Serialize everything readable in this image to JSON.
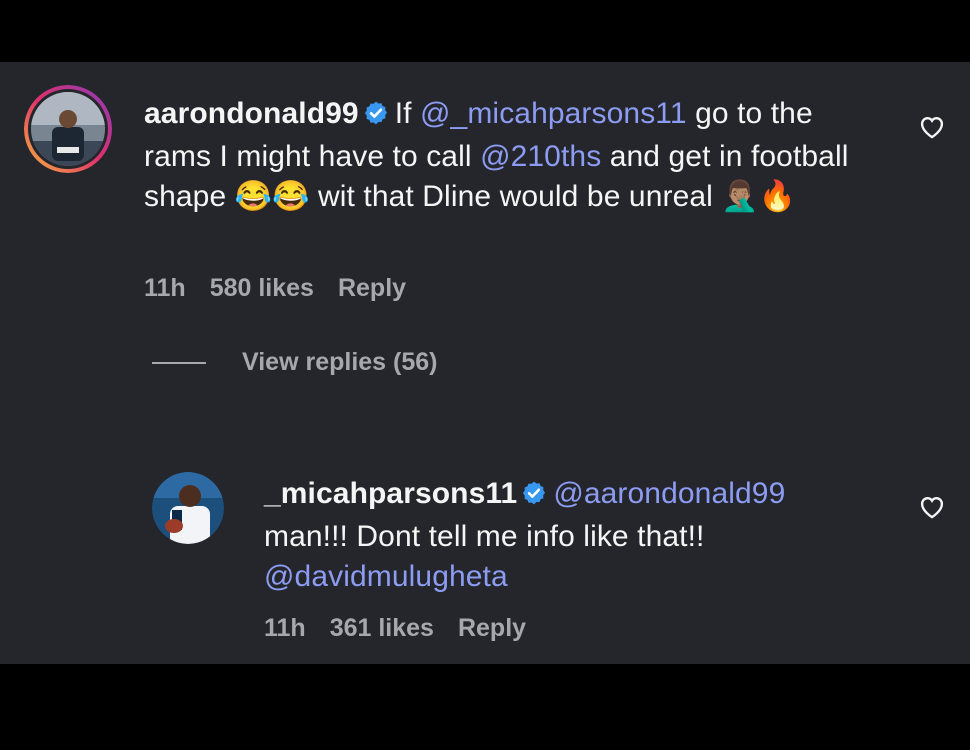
{
  "comments": [
    {
      "username": "aarondonald99",
      "verified": true,
      "text_parts": [
        {
          "text": "If ",
          "mention": false
        },
        {
          "text": "@_micahparsons11",
          "mention": true
        },
        {
          "text": " go to the rams I might have to call ",
          "mention": false
        },
        {
          "text": "@210ths",
          "mention": true
        },
        {
          "text": " and get in football shape 😂😂 wit that Dline would be unreal 🤦🏽‍♂️🔥",
          "mention": false
        }
      ],
      "time": "11h",
      "likes": "580 likes",
      "reply_label": "Reply",
      "icon": "heart-outline-icon"
    },
    {
      "username": "_micahparsons11",
      "verified": true,
      "text_parts": [
        {
          "text": "@aarondonald99",
          "mention": true
        },
        {
          "text": " man!!! Dont tell me info like that!! ",
          "mention": false
        },
        {
          "text": "@davidmulugheta",
          "mention": true
        }
      ],
      "time": "11h",
      "likes": "361 likes",
      "reply_label": "Reply",
      "icon": "heart-outline-icon"
    }
  ],
  "view_replies": "View replies (56)",
  "colors": {
    "background": "#25262b",
    "mention": "#8c9cf2",
    "verified": "#3897f0",
    "meta": "#a7a8ae",
    "story_ring": [
      "#f5b33e",
      "#e1306c",
      "#8a3ab9"
    ]
  }
}
